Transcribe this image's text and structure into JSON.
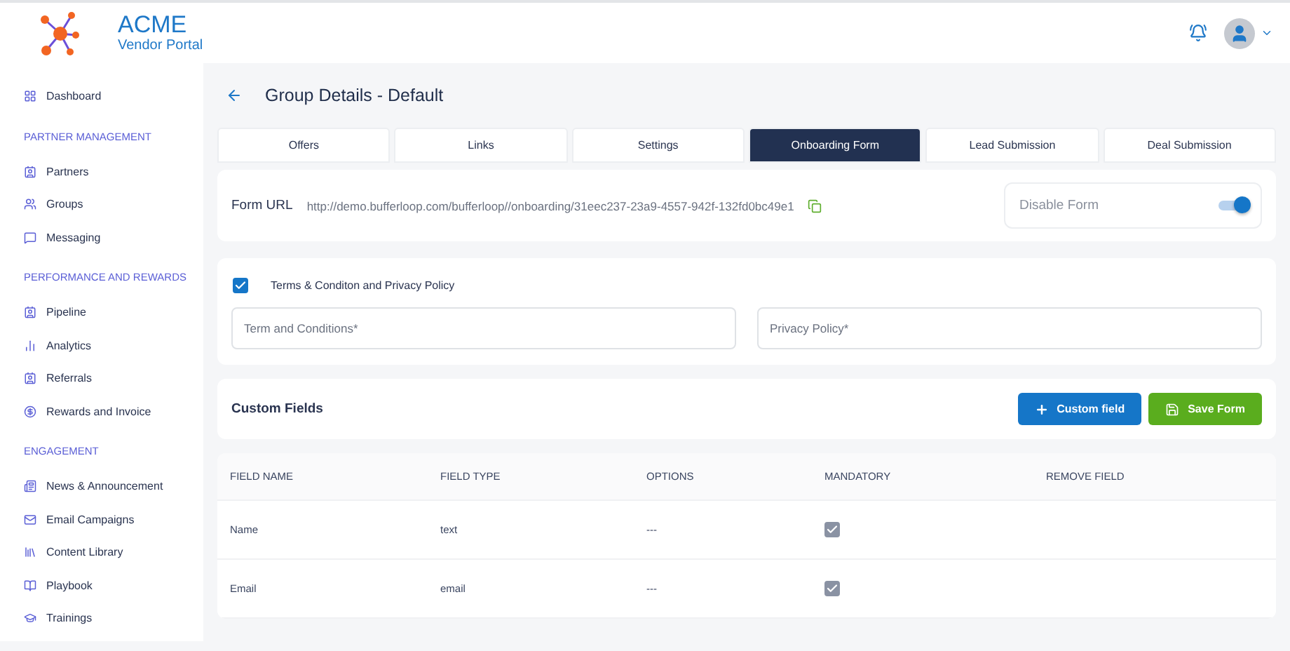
{
  "brand": {
    "name": "ACME",
    "subtitle": "Vendor Portal"
  },
  "sidebar": [
    {
      "kind": "item",
      "label": "Dashboard"
    },
    {
      "kind": "section",
      "label": "PARTNER MANAGEMENT"
    },
    {
      "kind": "item",
      "label": "Partners"
    },
    {
      "kind": "item",
      "label": "Groups"
    },
    {
      "kind": "item",
      "label": "Messaging"
    },
    {
      "kind": "section",
      "label": "PERFORMANCE AND REWARDS"
    },
    {
      "kind": "item",
      "label": "Pipeline"
    },
    {
      "kind": "item",
      "label": "Analytics"
    },
    {
      "kind": "item",
      "label": "Referrals"
    },
    {
      "kind": "item",
      "label": "Rewards and Invoice"
    },
    {
      "kind": "section",
      "label": "ENGAGEMENT"
    },
    {
      "kind": "item",
      "label": "News & Announcement"
    },
    {
      "kind": "item",
      "label": "Email Campaigns"
    },
    {
      "kind": "item",
      "label": "Content Library"
    },
    {
      "kind": "item",
      "label": "Playbook"
    },
    {
      "kind": "item",
      "label": "Trainings"
    }
  ],
  "page_title": "Group Details - Default",
  "tabs": [
    {
      "label": "Offers",
      "selected": false
    },
    {
      "label": "Links",
      "selected": false
    },
    {
      "label": "Settings",
      "selected": false
    },
    {
      "label": "Onboarding Form",
      "selected": true
    },
    {
      "label": "Lead Submission",
      "selected": false
    },
    {
      "label": "Deal Submission",
      "selected": false
    }
  ],
  "form_url": {
    "label": "Form URL",
    "value": "http://demo.bufferloop.com/bufferloop//onboarding/31eec237-23a9-4557-942f-132fd0bc49e1"
  },
  "disable_form": {
    "label": "Disable Form",
    "on": true
  },
  "terms": {
    "label": "Terms & Conditon and Privacy Policy",
    "checked": true,
    "fields": [
      {
        "placeholder": "Term and Conditions*"
      },
      {
        "placeholder": "Privacy Policy*"
      }
    ]
  },
  "custom_fields": {
    "title": "Custom Fields",
    "add_button": "Custom field",
    "save_button": "Save Form"
  },
  "table": {
    "columns": [
      "FIELD NAME",
      "FIELD TYPE",
      "OPTIONS",
      "MANDATORY",
      "REMOVE FIELD"
    ],
    "rows": [
      {
        "name": "Name",
        "type": "text",
        "options": "---",
        "mandatory": true
      },
      {
        "name": "Email",
        "type": "email",
        "options": "---",
        "mandatory": true
      }
    ]
  }
}
